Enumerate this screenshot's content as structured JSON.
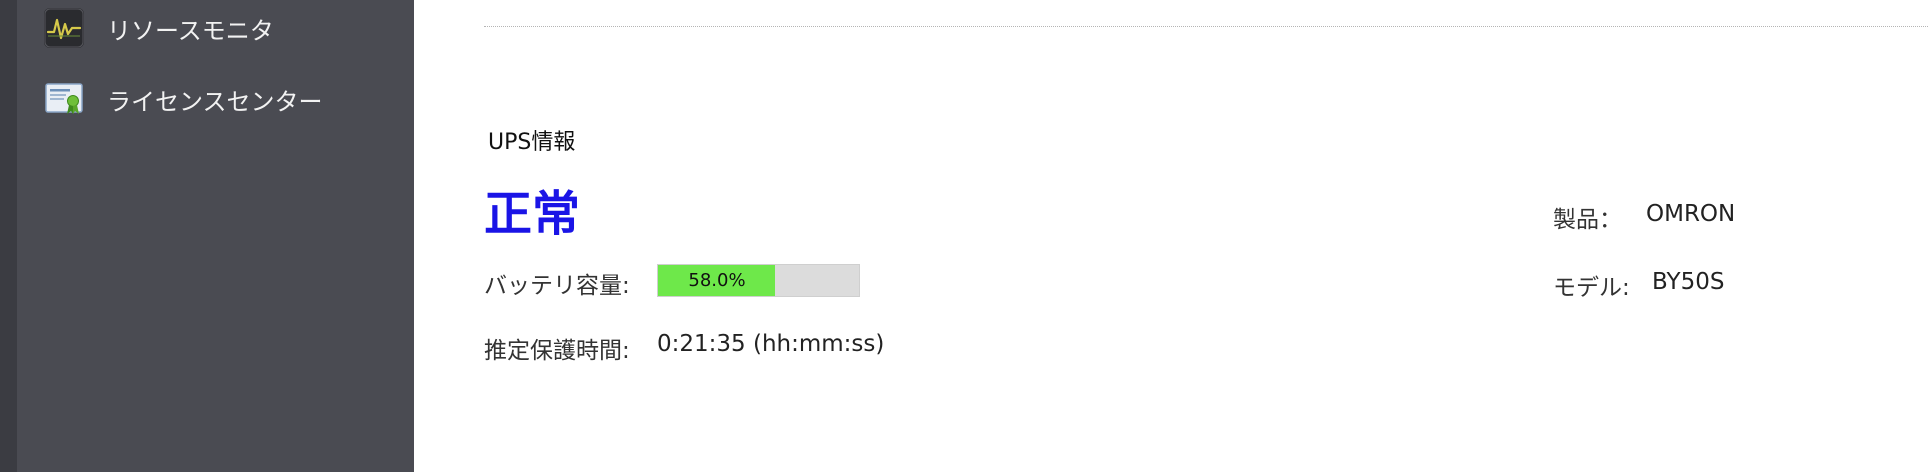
{
  "sidebar": {
    "items": [
      {
        "label": "リソースモニタ",
        "icon": "resource-monitor-icon"
      },
      {
        "label": "ライセンスセンター",
        "icon": "license-certificate-icon"
      }
    ]
  },
  "ups": {
    "section_title": "UPS情報",
    "status": "正常",
    "status_color": "#1a14e6",
    "battery_label": "バッテリ容量:",
    "battery_percent": 58.0,
    "battery_text": "58.0%",
    "battery_color": "#6ee84a",
    "runtime_label": "推定保護時間:",
    "runtime_value": "0:21:35 (hh:mm:ss)",
    "product_label": "製品：",
    "product_value": "OMRON",
    "model_label": "モデル:",
    "model_value": "BY50S"
  }
}
